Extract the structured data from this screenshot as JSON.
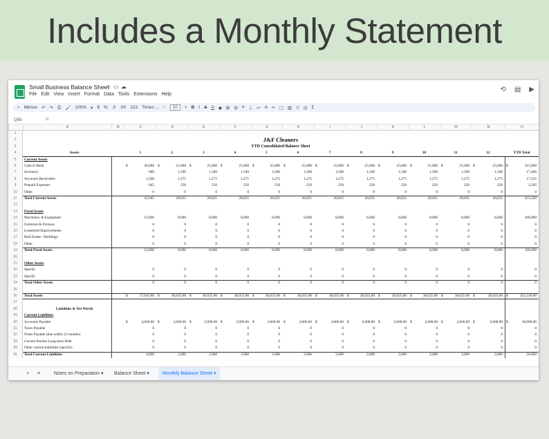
{
  "banner": {
    "title": "Includes a Monthly Statement"
  },
  "app": {
    "doc_title": "Small Business Balance Sheet",
    "menus": [
      "File",
      "Edit",
      "View",
      "Insert",
      "Format",
      "Data",
      "Tools",
      "Extensions",
      "Help"
    ],
    "cell_ref": "Q58",
    "fx": "fx"
  },
  "toolbar": {
    "menus_label": "Menus",
    "zoom": "100%",
    "currency": "$",
    "percent": "%",
    "dec_decrease": ".0",
    "dec_increase": ".00",
    "number_format": "123",
    "font": "Times ...",
    "font_size": "10"
  },
  "columns": [
    "A",
    "B",
    "C",
    "D",
    "E",
    "F",
    "G",
    "H",
    "I",
    "J",
    "K",
    "L",
    "M",
    "N",
    "O"
  ],
  "sheet": {
    "company": "J&F Cleaners",
    "subtitle": "YTD Consolidated Balance Sheet",
    "assets_label": "Assets",
    "months": [
      "1",
      "2",
      "3",
      "4",
      "5",
      "6",
      "7",
      "8",
      "9",
      "10",
      "11",
      "12"
    ],
    "ytd_label": "YTD Total",
    "liab_label": "Liabilities & Net Worth"
  },
  "rows": [
    {
      "n": "1"
    },
    {
      "n": "2",
      "special": "company"
    },
    {
      "n": "3",
      "special": "subtitle"
    },
    {
      "n": "4",
      "special": "months"
    },
    {
      "n": "5",
      "label": "Current Assets",
      "style": "head"
    },
    {
      "n": "6",
      "label": "Cash in Bank",
      "dollar": true,
      "values": [
        "40,000",
        "25,000",
        "25,000",
        "25,000",
        "25,000",
        "25,000",
        "25,000",
        "25,000",
        "25,000",
        "25,000",
        "25,000",
        "25,000",
        "315,000"
      ]
    },
    {
      "n": "7",
      "label": "Inventory",
      "values": [
        "900",
        "1,500",
        "1,500",
        "1,500",
        "1,500",
        "1,500",
        "1,500",
        "1,500",
        "1,500",
        "1,500",
        "1,500",
        "1,500",
        "17,400"
      ]
    },
    {
      "n": "8",
      "label": "Accounts Receivable",
      "values": [
        "3,500",
        "1,275",
        "1,275",
        "1,275",
        "1,275",
        "1,275",
        "1,275",
        "1,275",
        "1,275",
        "1,275",
        "1,275",
        "1,275",
        "17,525"
      ]
    },
    {
      "n": "9",
      "label": "Prepaid Expenses",
      "values": [
        "645",
        "250",
        "250",
        "250",
        "250",
        "250",
        "250",
        "250",
        "250",
        "250",
        "250",
        "250",
        "3,395"
      ]
    },
    {
      "n": "10",
      "label": "Other",
      "values": [
        "0",
        "0",
        "0",
        "0",
        "0",
        "0",
        "0",
        "0",
        "0",
        "0",
        "0",
        "0",
        "0"
      ]
    },
    {
      "n": "11",
      "label": "Total Current Assets",
      "style": "total",
      "values": [
        "45,045",
        "28,025",
        "28,025",
        "28,025",
        "28,025",
        "28,025",
        "28,025",
        "28,025",
        "28,025",
        "28,025",
        "28,025",
        "28,025",
        "353,320"
      ]
    },
    {
      "n": "12"
    },
    {
      "n": "13",
      "label": "Fixed Assets",
      "style": "head"
    },
    {
      "n": "14",
      "label": "Machinery & Equipment",
      "values": [
        "12,000",
        "8,000",
        "8,000",
        "8,000",
        "8,000",
        "8,000",
        "8,000",
        "8,000",
        "8,000",
        "8,000",
        "8,000",
        "8,000",
        "100,000"
      ]
    },
    {
      "n": "15",
      "label": "Furniture & Fixtures",
      "values": [
        "0",
        "0",
        "0",
        "0",
        "0",
        "0",
        "0",
        "0",
        "0",
        "0",
        "0",
        "0",
        "0"
      ]
    },
    {
      "n": "16",
      "label": "Leasehold Improvements",
      "values": [
        "0",
        "0",
        "0",
        "0",
        "0",
        "0",
        "0",
        "0",
        "0",
        "0",
        "0",
        "0",
        "0"
      ]
    },
    {
      "n": "17",
      "label": "Real Estate / Buildings",
      "values": [
        "0",
        "0",
        "0",
        "0",
        "0",
        "0",
        "0",
        "0",
        "0",
        "0",
        "0",
        "0",
        "0"
      ]
    },
    {
      "n": "18",
      "label": "Other",
      "values": [
        "0",
        "0",
        "0",
        "0",
        "0",
        "0",
        "0",
        "0",
        "0",
        "0",
        "0",
        "0",
        "0"
      ]
    },
    {
      "n": "19",
      "label": "Total Fixed Assets",
      "style": "total",
      "values": [
        "12,000",
        "8,000",
        "8,000",
        "8,000",
        "8,000",
        "8,000",
        "8,000",
        "8,000",
        "8,000",
        "8,000",
        "8,000",
        "8,000",
        "100,000"
      ]
    },
    {
      "n": "20"
    },
    {
      "n": "21",
      "label": "Other Assets",
      "style": "head"
    },
    {
      "n": "22",
      "label": "Specify",
      "values": [
        "0",
        "0",
        "0",
        "0",
        "0",
        "0",
        "0",
        "0",
        "0",
        "0",
        "0",
        "0",
        "0"
      ]
    },
    {
      "n": "23",
      "label": "Specify",
      "values": [
        "0",
        "0",
        "0",
        "0",
        "0",
        "0",
        "0",
        "0",
        "0",
        "0",
        "0",
        "0",
        "0"
      ]
    },
    {
      "n": "24",
      "label": "Total Other Assets",
      "style": "total",
      "values": [
        "0",
        "0",
        "0",
        "0",
        "0",
        "0",
        "0",
        "0",
        "0",
        "0",
        "0",
        "0",
        "0"
      ]
    },
    {
      "n": "25"
    },
    {
      "n": "26",
      "label": "Total Assets",
      "style": "grand",
      "dollar": true,
      "values": [
        "57,045.00",
        "36,025.00",
        "36,025.00",
        "36,025.00",
        "36,025.00",
        "36,025.00",
        "36,025.00",
        "36,025.00",
        "36,025.00",
        "36,025.00",
        "36,025.00",
        "36,025.00",
        "453,320.00"
      ]
    },
    {
      "n": "27"
    },
    {
      "n": "28",
      "special": "liab"
    },
    {
      "n": "29",
      "label": "Current Liabilities",
      "style": "head"
    },
    {
      "n": "30",
      "label": "Accounts Payable",
      "dollar": true,
      "values": [
        "4,000.00",
        "2,000.00",
        "2,000.00",
        "2,000.00",
        "2,000.00",
        "2,000.00",
        "2,000.00",
        "2,000.00",
        "2,000.00",
        "2,000.00",
        "2,000.00",
        "2,000.00",
        "26,000.00"
      ]
    },
    {
      "n": "31",
      "label": "Taxes Payable",
      "values": [
        "0",
        "0",
        "0",
        "0",
        "0",
        "0",
        "0",
        "0",
        "0",
        "0",
        "0",
        "0",
        "0"
      ]
    },
    {
      "n": "32",
      "label": "Notes Payable (due within 12 months)",
      "values": [
        "0",
        "0",
        "0",
        "0",
        "0",
        "0",
        "0",
        "0",
        "0",
        "0",
        "0",
        "0",
        "0"
      ]
    },
    {
      "n": "33",
      "label": "Current Portion Long-term Debt",
      "values": [
        "0",
        "0",
        "0",
        "0",
        "0",
        "0",
        "0",
        "0",
        "0",
        "0",
        "0",
        "0",
        "0"
      ]
    },
    {
      "n": "34",
      "label": "Other current liabilities (specify)",
      "values": [
        "0",
        "0",
        "0",
        "0",
        "0",
        "0",
        "0",
        "0",
        "0",
        "0",
        "0",
        "0",
        "0"
      ]
    },
    {
      "n": "35",
      "label": "Total Current Liabilities",
      "style": "total",
      "values": [
        "4,000",
        "2,000",
        "2,000",
        "2,000",
        "2,000",
        "2,000",
        "2,000",
        "2,000",
        "2,000",
        "2,000",
        "2,000",
        "2,000",
        "26,000"
      ]
    }
  ],
  "tabs": [
    "Notes on Preparation",
    "Balance Sheet",
    "Monthly Balance Sheet"
  ],
  "active_tab": "Monthly Balance Sheet"
}
